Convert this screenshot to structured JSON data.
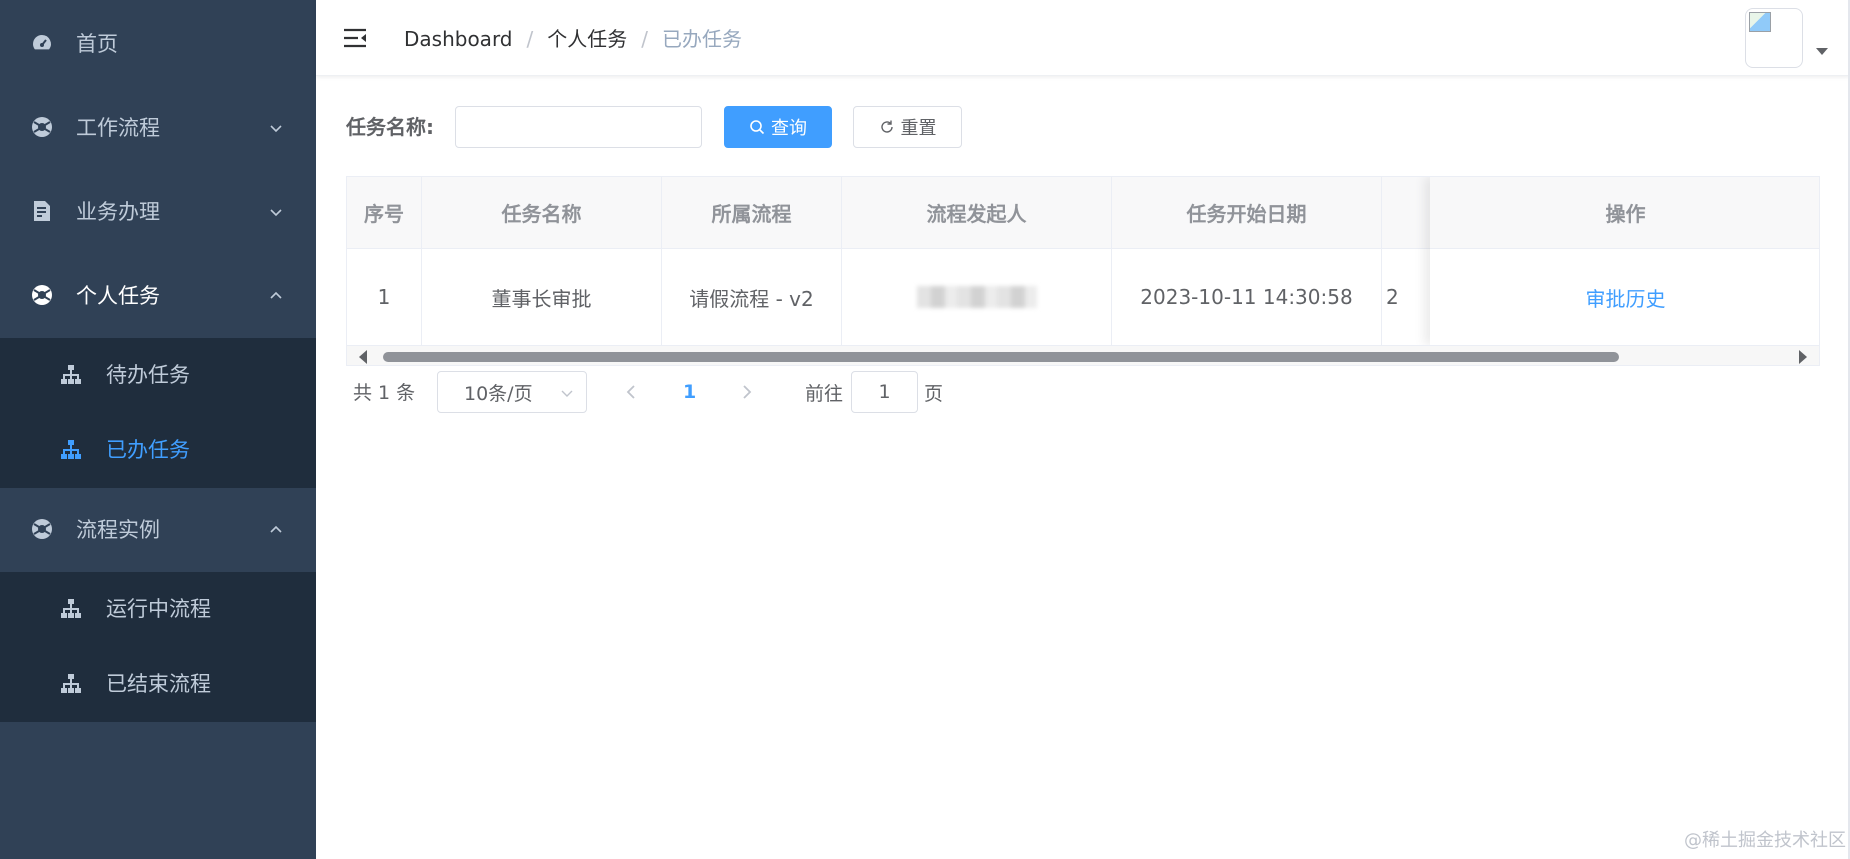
{
  "sidebar": {
    "home": "首页",
    "workflow": "工作流程",
    "business": "业务办理",
    "personal_tasks": "个人任务",
    "todo_tasks": "待办任务",
    "done_tasks": "已办任务",
    "process_instance": "流程实例",
    "running_process": "运行中流程",
    "finished_process": "已结束流程"
  },
  "breadcrumb": [
    "Dashboard",
    "个人任务",
    "已办任务"
  ],
  "breadcrumb_separator": "/",
  "search": {
    "label": "任务名称:",
    "value": "",
    "placeholder": "",
    "query_label": "查询",
    "reset_label": "重置"
  },
  "table": {
    "headers": [
      "序号",
      "任务名称",
      "所属流程",
      "流程发起人",
      "任务开始日期",
      "操作"
    ],
    "rows": [
      {
        "index": "1",
        "task_name": "董事长审批",
        "process": "请假流程 - v2",
        "initiator": "",
        "start_date": "2023-10-11 14:30:58",
        "partial_next": "2",
        "action": "审批历史"
      }
    ]
  },
  "pagination": {
    "total": "共 1 条",
    "page_size": "10条/页",
    "current_page": "1",
    "goto_label": "前往",
    "goto_value": "1",
    "page_unit": "页"
  },
  "watermark": "@稀土掘金技术社区",
  "colors": {
    "sidebar_bg": "#304156",
    "submenu_bg": "#1f2d3d",
    "primary": "#409eff",
    "menu_text": "#bfcbd9"
  }
}
